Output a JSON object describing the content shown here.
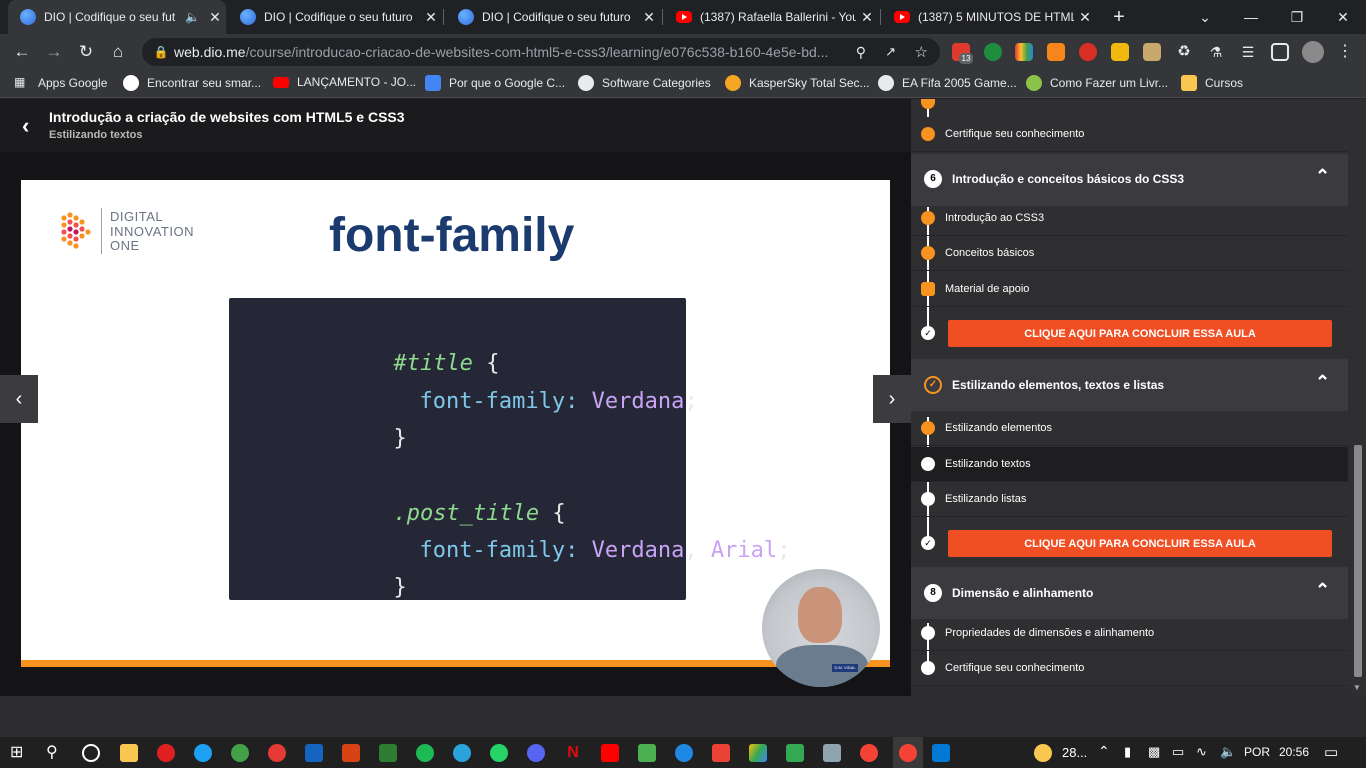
{
  "browser": {
    "tabs": [
      {
        "title": "DIO | Codifique o seu fut",
        "favicon": "dio-icon",
        "audio": true,
        "active": true
      },
      {
        "title": "DIO | Codifique o seu futuro",
        "favicon": "dio-icon"
      },
      {
        "title": "DIO | Codifique o seu futuro",
        "favicon": "dio-icon"
      },
      {
        "title": "(1387) Rafaella Ballerini - You",
        "favicon": "youtube-icon"
      },
      {
        "title": "(1387) 5 MINUTOS DE HTML",
        "favicon": "youtube-icon"
      }
    ],
    "new_tab_glyph": "+",
    "url_host": "web.dio.me",
    "url_path": "/course/introducao-criacao-de-websites-com-html5-e-css3/learning/e076c538-b160-4e5e-bd...",
    "extension_badge": "13",
    "bookmarks": [
      {
        "label": "Apps Google",
        "icon": "apps-grid-icon"
      },
      {
        "label": "Encontrar seu smar...",
        "icon": "google-icon"
      },
      {
        "label": "LANÇAMENTO - JO...",
        "icon": "youtube-icon"
      },
      {
        "label": "Por que o Google C...",
        "icon": "bookmark-blue-icon"
      },
      {
        "label": "Software Categories",
        "icon": "globe-icon"
      },
      {
        "label": "KasperSky Total Sec...",
        "icon": "kaspersky-icon"
      },
      {
        "label": "EA Fifa 2005 Game...",
        "icon": "globe-icon"
      },
      {
        "label": "Como Fazer um Livr...",
        "icon": "book-icon"
      },
      {
        "label": "Cursos",
        "icon": "folder-icon"
      }
    ]
  },
  "lesson": {
    "course_title": "Introdução a criação de websites com HTML5 e CSS3",
    "lesson_title": "Estilizando textos"
  },
  "slide": {
    "logo_line1": "DIGITAL",
    "logo_line2": "INNOVATION",
    "logo_line3": "ONE",
    "heading": "font-family",
    "code": {
      "sel1": "#title",
      "brace_open": "{",
      "brace_close": "}",
      "prop": "font-family",
      "colon": ":",
      "val1": "Verdana",
      "semicolon": ";",
      "sel2": ".post_title",
      "val2a": "Verdana",
      "comma": ",",
      "val2b": "Arial"
    },
    "badge_text": "D.M. VIDAL"
  },
  "sidebar": {
    "top_item": "Certifique seu conhecimento",
    "section6": {
      "number": "6",
      "title": "Introdução e conceitos básicos do CSS3"
    },
    "section6_items": [
      "Introdução ao CSS3",
      "Conceitos básicos",
      "Material de apoio"
    ],
    "cta_label": "CLIQUE AQUI PARA CONCLUIR ESSA AULA",
    "section7": {
      "title": "Estilizando elementos, textos e listas"
    },
    "section7_items": [
      "Estilizando elementos",
      "Estilizando textos",
      "Estilizando listas"
    ],
    "section8": {
      "number": "8",
      "title": "Dimensão e alinhamento"
    },
    "section8_items": [
      "Propriedades de dimensões e alinhamento",
      "Certifique seu conhecimento"
    ]
  },
  "taskbar": {
    "weather": "28...",
    "language": "POR",
    "time": "20:56"
  },
  "colors": {
    "accent": "#f04e23",
    "orange": "#f7931e",
    "dio_navy": "#1b3b6f",
    "code_bg": "#252736",
    "code_green": "#8fd98f",
    "code_blue": "#7fc7e8",
    "code_purple": "#c9a3f5"
  }
}
